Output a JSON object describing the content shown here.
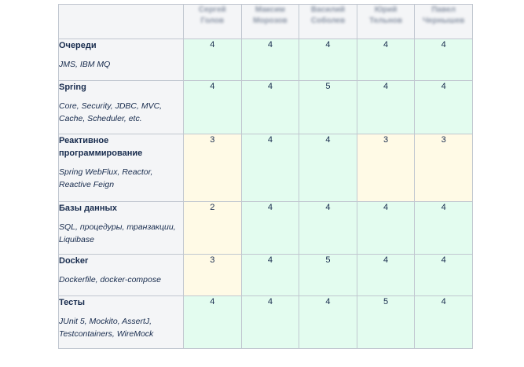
{
  "table": {
    "columns": [
      "Сергей Голов",
      "Максим Морозов",
      "Василий Соболев",
      "Юрий Тельнов",
      "Павел Чернышев"
    ],
    "rows": [
      {
        "name": "Очереди",
        "desc": "JMS, IBM MQ",
        "values": [
          "4",
          "4",
          "4",
          "4",
          "4"
        ],
        "colors": [
          "g",
          "g",
          "g",
          "g",
          "g"
        ]
      },
      {
        "name": "Spring",
        "desc": "Core, Security, JDBC, MVC, Cache, Scheduler, etc.",
        "values": [
          "4",
          "4",
          "5",
          "4",
          "4"
        ],
        "colors": [
          "g",
          "g",
          "g",
          "g",
          "g"
        ]
      },
      {
        "name": "Реактивное программирование",
        "desc": "Spring WebFlux, Reactor, Reactive Feign",
        "values": [
          "3",
          "4",
          "4",
          "3",
          "3"
        ],
        "colors": [
          "y",
          "g",
          "g",
          "y",
          "y"
        ]
      },
      {
        "name": "Базы данных",
        "desc": "SQL, процедуры, транзакции, Liquibase",
        "values": [
          "2",
          "4",
          "4",
          "4",
          "4"
        ],
        "colors": [
          "y",
          "g",
          "g",
          "g",
          "g"
        ]
      },
      {
        "name": "Docker",
        "desc": "Dockerfile, docker-compose",
        "values": [
          "3",
          "4",
          "5",
          "4",
          "4"
        ],
        "colors": [
          "y",
          "g",
          "g",
          "g",
          "g"
        ]
      },
      {
        "name": "Тесты",
        "desc": "JUnit 5, Mockito, AssertJ, Testcontainers, WireMock",
        "values": [
          "4",
          "4",
          "4",
          "5",
          "4"
        ],
        "colors": [
          "g",
          "g",
          "g",
          "g",
          "g"
        ]
      }
    ]
  },
  "colors": {
    "good": "#e3fcef",
    "warn": "#fffae6",
    "header": "#f4f5f7",
    "border": "#c1c7d0"
  }
}
